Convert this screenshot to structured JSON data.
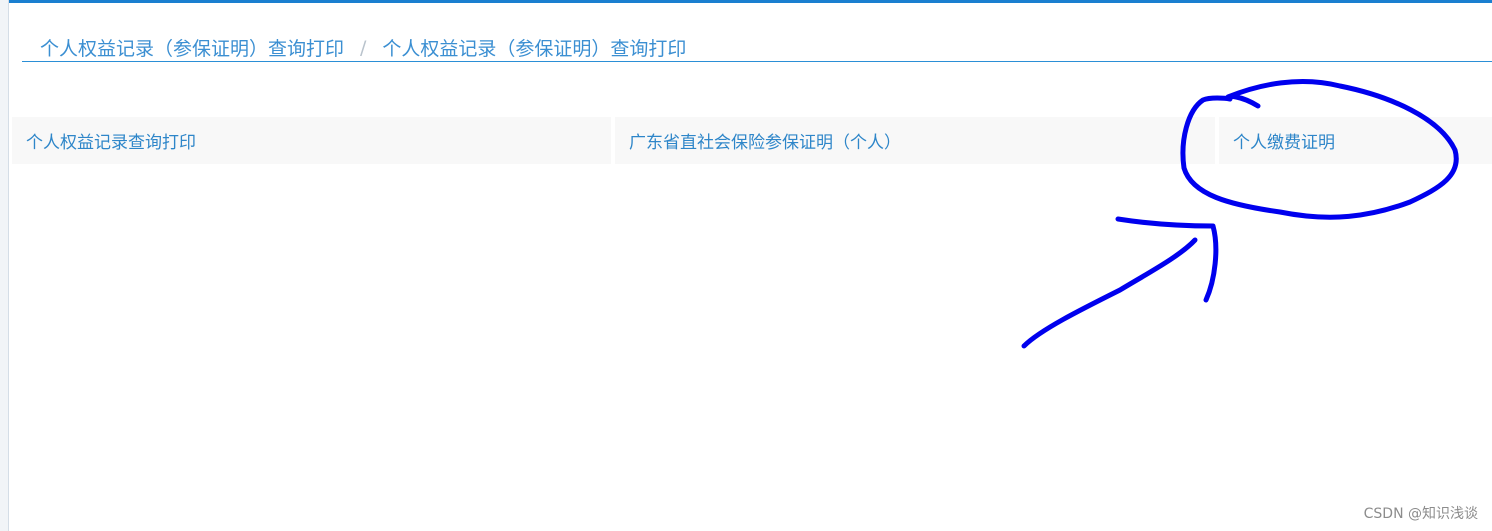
{
  "breadcrumb": {
    "items": [
      "个人权益记录（参保证明）查询打印",
      "个人权益记录（参保证明）查询打印"
    ],
    "separator": "/"
  },
  "tabs": [
    {
      "label": "个人权益记录查询打印"
    },
    {
      "label": "广东省直社会保险参保证明（个人）"
    },
    {
      "label": "个人缴费证明"
    }
  ],
  "watermark": "CSDN @知识浅谈",
  "colors": {
    "accent": "#1a7fd0",
    "link_text": "#3b8fd2",
    "tab_background": "#f8f8f8",
    "annotation": "#0000ee"
  }
}
